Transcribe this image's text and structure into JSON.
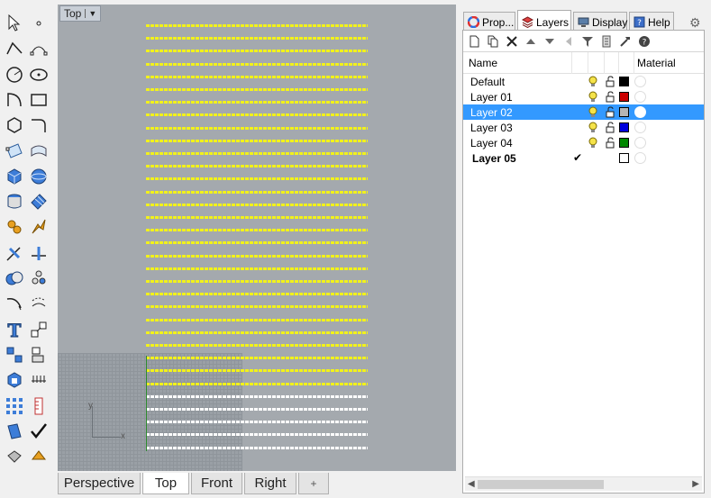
{
  "toolbar": {
    "tools": [
      "select-arrow-icon",
      "point-icon",
      "polyline-icon",
      "curve-points-icon",
      "circle-icon",
      "ellipse-icon",
      "arc-icon",
      "rectangle-icon",
      "polygon-icon",
      "fillet-curve-icon",
      "surface-points-icon",
      "loft-icon",
      "box-icon",
      "sphere-icon",
      "cylinder-icon",
      "patch-icon",
      "gear-solid-icon",
      "explode-icon",
      "trim-icon",
      "split-icon",
      "boolean-icon",
      "group-icon",
      "fillet-edges-icon",
      "offset-icon",
      "text-icon",
      "scale-icon",
      "array-icon",
      "align-icon",
      "block-icon",
      "dimension-icon",
      "grid-array-icon",
      "ruler-icon",
      "surface-analysis-icon",
      "check-icon",
      "render-icon",
      "material-icon"
    ]
  },
  "viewport": {
    "title": "Top",
    "dropdown_glyph": "▼",
    "row_colors": {
      "yellow": "#f2f21a",
      "white": "#ffffff"
    },
    "yellow_rows": 29,
    "white_rows": 5,
    "axis_x": "x",
    "axis_y": "y",
    "tabs": [
      "Perspective",
      "Top",
      "Front",
      "Right"
    ],
    "active_tab": "Top",
    "add_tab_glyph": "+"
  },
  "panel": {
    "tabs": [
      {
        "label": "Prop...",
        "icon": "color-wheel-icon"
      },
      {
        "label": "Layers",
        "icon": "layers-icon"
      },
      {
        "label": "Display",
        "icon": "display-icon"
      },
      {
        "label": "Help",
        "icon": "help-icon"
      }
    ],
    "active_tab": "Layers",
    "layer_toolbar": [
      "new-layer-icon",
      "new-sublayer-icon",
      "delete-layer-icon",
      "move-up-icon",
      "move-down-icon",
      "move-left-icon",
      "filter-icon",
      "layer-states-icon",
      "tools-icon",
      "help-circle-icon"
    ],
    "columns": {
      "name": "Name",
      "material": "Material"
    },
    "layers": [
      {
        "name": "Default",
        "color": "#000000",
        "current": false,
        "selected": false
      },
      {
        "name": "Layer 01",
        "color": "#cc0000",
        "current": false,
        "selected": false
      },
      {
        "name": "Layer 02",
        "color": "#b4b4b4",
        "current": false,
        "selected": true
      },
      {
        "name": "Layer 03",
        "color": "#0000dd",
        "current": false,
        "selected": false
      },
      {
        "name": "Layer 04",
        "color": "#008800",
        "current": false,
        "selected": false
      },
      {
        "name": "Layer 05",
        "color": "#ffffff",
        "current": true,
        "selected": false
      }
    ],
    "check_glyph": "✔",
    "gear_glyph": "⚙",
    "scroll_left": "◀",
    "scroll_right": "▶"
  }
}
